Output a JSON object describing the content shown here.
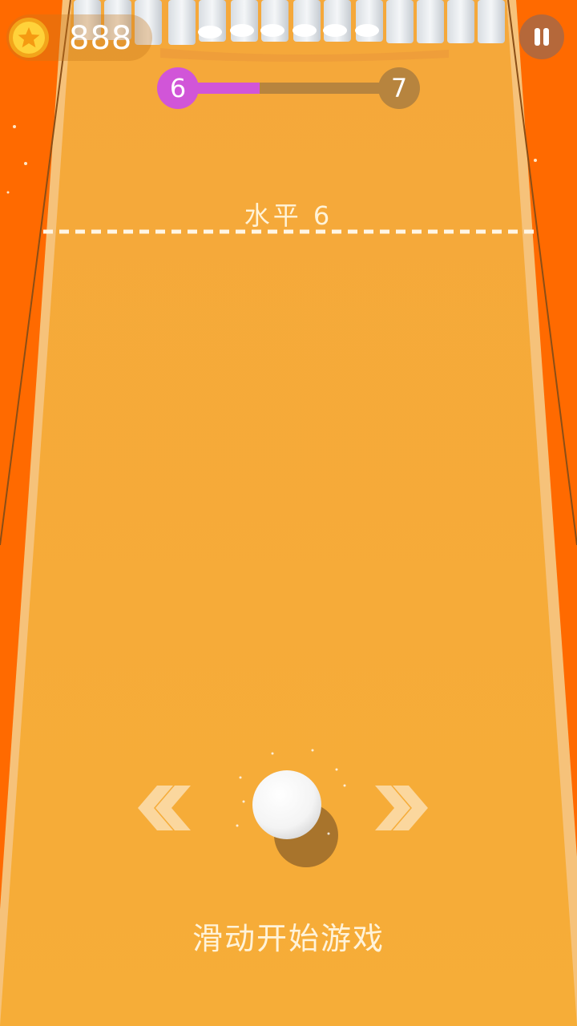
{
  "hud": {
    "coin_icon": "gold-star-coin-icon",
    "coins": "888",
    "pause_icon": "pause-icon"
  },
  "progress": {
    "current_level": "6",
    "next_level": "7",
    "fill_fraction": 0.35
  },
  "track": {
    "level_label": "水平 6"
  },
  "controls": {
    "left_icon": "double-chevron-left-icon",
    "right_icon": "double-chevron-right-icon",
    "hint": "滑动开始游戏"
  },
  "colors": {
    "background": "#ff6a00",
    "track": "#f5ad3a",
    "progress_accent": "#d155d8",
    "progress_track": "#b7843e"
  }
}
